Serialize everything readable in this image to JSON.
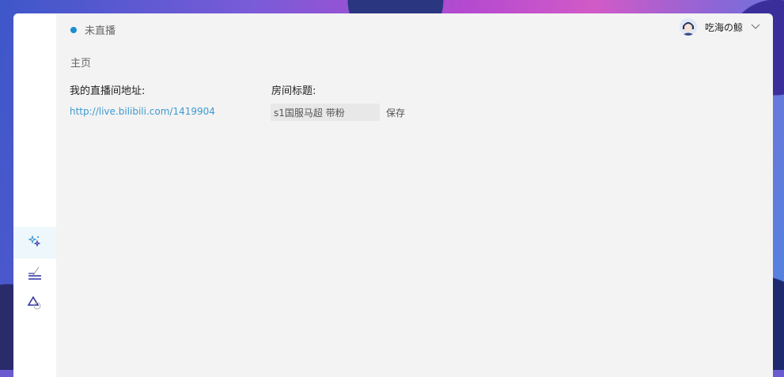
{
  "header": {
    "status_text": "未直播",
    "status_color": "#1a8fd0",
    "username": "吃海の鲸",
    "avatar_icon": "user-avatar",
    "dropdown_icon": "chevron-down-icon"
  },
  "sidebar": {
    "items": [
      {
        "icon": "sparkle-icon",
        "active": true
      },
      {
        "icon": "pen-edit-icon",
        "active": false
      },
      {
        "icon": "triangle-circle-icon",
        "active": false
      }
    ]
  },
  "main": {
    "breadcrumb": "主页",
    "room_url_label": "我的直播间地址:",
    "room_url": "http://live.bilibili.com/1419904",
    "room_title_label": "房间标题:",
    "room_title_value": "s1国服马超 带粉",
    "save_label": "保存"
  },
  "colors": {
    "accent": "#1a8fd0",
    "link": "#3e9ad0",
    "panel_bg": "#f3f3f3",
    "sidebar_icon": "#2b2fa0"
  }
}
